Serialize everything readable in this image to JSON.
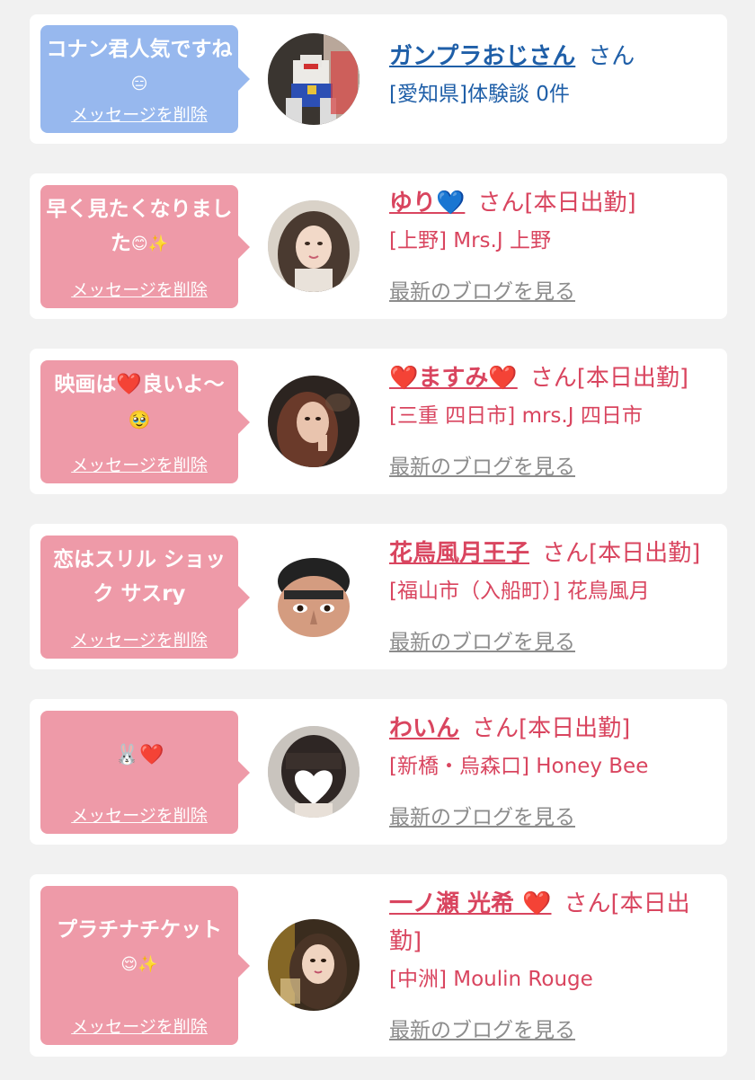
{
  "cards": [
    {
      "bubble_text": "コナン君人気ですね",
      "bubble_emoji": "😑",
      "delete_label": "メッセージを削除",
      "name": "ガンプラおじさん",
      "san": "さん",
      "shop": "[愛知県]体験談 0件",
      "colors": {
        "bubble": "#97b8ee",
        "text": "#1f5fa8"
      }
    },
    {
      "bubble_text": "早く見たくなりました",
      "bubble_emoji": "😊✨",
      "delete_label": "メッセージを削除",
      "name": "ゆり💙",
      "san": "さん[本日出勤]",
      "shop": "[上野] Mrs.J 上野",
      "blog": "最新のブログを見る",
      "colors": {
        "bubble": "#ee9aa8",
        "text": "#d9455f"
      }
    },
    {
      "bubble_text": "映画は❤️良いよ〜",
      "bubble_emoji": "🥹",
      "delete_label": "メッセージを削除",
      "name": "❤️ますみ❤️",
      "san": "さん[本日出勤]",
      "shop": "[三重 四日市] mrs.J 四日市",
      "blog": "最新のブログを見る",
      "colors": {
        "bubble": "#ee9aa8",
        "text": "#d9455f"
      }
    },
    {
      "bubble_text": "恋はスリル ショック サスry",
      "bubble_emoji": "",
      "delete_label": "メッセージを削除",
      "name": "花鳥風月王子",
      "san": "さん[本日出勤]",
      "shop": "[福山市（入船町）] 花鳥風月",
      "blog": "最新のブログを見る",
      "colors": {
        "bubble": "#ee9aa8",
        "text": "#d9455f"
      }
    },
    {
      "bubble_text": "",
      "bubble_emoji": "🐰❤️",
      "delete_label": "メッセージを削除",
      "name": "わいん",
      "san": "さん[本日出勤]",
      "shop": "[新橋・烏森口] Honey Bee",
      "blog": "最新のブログを見る",
      "colors": {
        "bubble": "#ee9aa8",
        "text": "#d9455f"
      }
    },
    {
      "bubble_text": "プラチナチケット",
      "bubble_emoji": "😌✨",
      "delete_label": "メッセージを削除",
      "name": "一ノ瀬 光希 ❤️",
      "san": "さん[本日出勤]",
      "shop": "[中洲] Moulin Rouge",
      "blog": "最新のブログを見る",
      "colors": {
        "bubble": "#ee9aa8",
        "text": "#d9455f"
      }
    }
  ]
}
